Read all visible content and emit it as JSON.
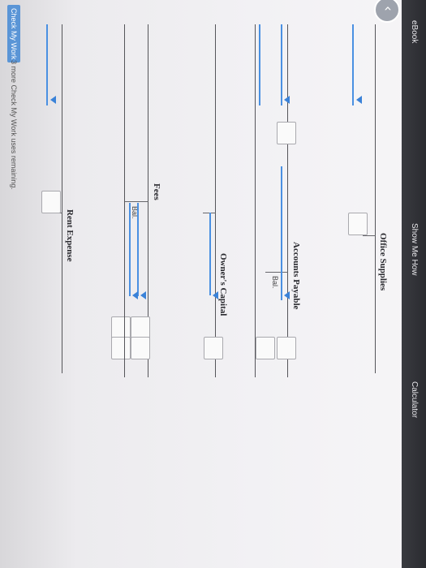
{
  "toolbar": {
    "ebook": "eBook",
    "show_me_how": "Show Me How",
    "calculator": "Calculator"
  },
  "back_glyph": "‹",
  "accounts": {
    "office_supplies": {
      "title": "Office Supplies"
    },
    "accounts_payable": {
      "title": "Accounts Payable",
      "bal_label": "Bal."
    },
    "owners_capital": {
      "title": "Owner's Capital"
    },
    "fees": {
      "title": "Fees",
      "bal_label": "Bal."
    },
    "rent_expense": {
      "title": "Rent Expense"
    }
  },
  "footer": {
    "check_button": "Check My Work",
    "note": "3 more Check My Work uses remaining."
  }
}
